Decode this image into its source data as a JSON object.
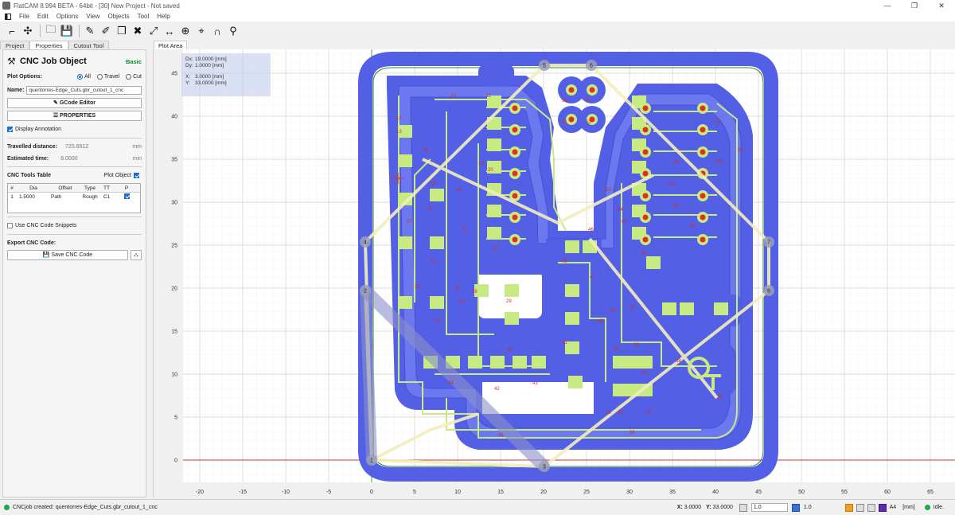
{
  "window": {
    "title": "FlatCAM 8.994 BETA - 64bit - [30]    New Project - Not saved",
    "min": "—",
    "max": "❐",
    "close": "✕"
  },
  "menu": [
    "File",
    "Edit",
    "Options",
    "View",
    "Objects",
    "Tool",
    "Help"
  ],
  "tabs": {
    "project": "Project",
    "properties": "Properties",
    "cutout": "Cutout Tool",
    "plot": "Plot Area"
  },
  "panel": {
    "title": "CNC Job Object",
    "level": "Basic",
    "plot_options_label": "Plot Options:",
    "radio_all": "All",
    "radio_travel": "Travel",
    "radio_cut": "Cut",
    "name_label": "Name:",
    "name_value": "quentorres-Edge_Cuts.gbr_cutout_1_cnc",
    "gcode_editor": "GCode Editor",
    "properties_btn": "PROPERTIES",
    "display_annotation": "Display Annotation",
    "travelled_label": "Travelled distance:",
    "travelled_value": "725.6912",
    "travelled_unit": "mm",
    "est_time_label": "Estimated time:",
    "est_time_value": "8.0000",
    "est_time_unit": "min",
    "tools_table_label": "CNC Tools Table",
    "plot_object": "Plot Object",
    "table_headers": [
      "#",
      "Dia",
      "Offset",
      "Type",
      "TT",
      "P"
    ],
    "table_rows": [
      [
        "1",
        "1.5000",
        "Path",
        "Rough",
        "C1"
      ]
    ],
    "use_snippets": "Use CNC Code Snippets",
    "export_label": "Export CNC Code:",
    "save_btn": "Save CNC Code"
  },
  "coords_box": {
    "dx_label": "Dx:",
    "dx": "19.0000 [mm]",
    "dy_label": "Dy:",
    "dy": "1.0000 [mm]",
    "x_label": "X:",
    "x": "3.0000 [mm]",
    "y_label": "Y:",
    "y": "33.0000 [mm]"
  },
  "axes": {
    "x_ticks": [
      "-20",
      "-15",
      "-10",
      "-5",
      "0",
      "5",
      "10",
      "15",
      "20",
      "25",
      "30",
      "35",
      "40",
      "45",
      "50",
      "55",
      "60",
      "65"
    ],
    "y_ticks": [
      "45",
      "40",
      "35",
      "30",
      "25",
      "20",
      "15",
      "10",
      "5",
      "0"
    ]
  },
  "travel_labels": [
    "1",
    "2",
    "3",
    "4",
    "5",
    "6",
    "7",
    "8"
  ],
  "colors": {
    "cut": "#5360e6",
    "trace": "#c8ea82",
    "travel": "#f3eebc",
    "drill": "#e03020",
    "accent": "#1e6fd0"
  },
  "status": {
    "message": "CNCjob created: quentorres-Edge_Cuts.gbr_cutout_1_cnc",
    "x_label": "X:",
    "x": "3.0000",
    "y_label": "Y:",
    "y": "33.0000",
    "grid1": "1.0",
    "grid2": "1.0",
    "paper": "A4",
    "units": "[mm]",
    "state": "Idle."
  }
}
